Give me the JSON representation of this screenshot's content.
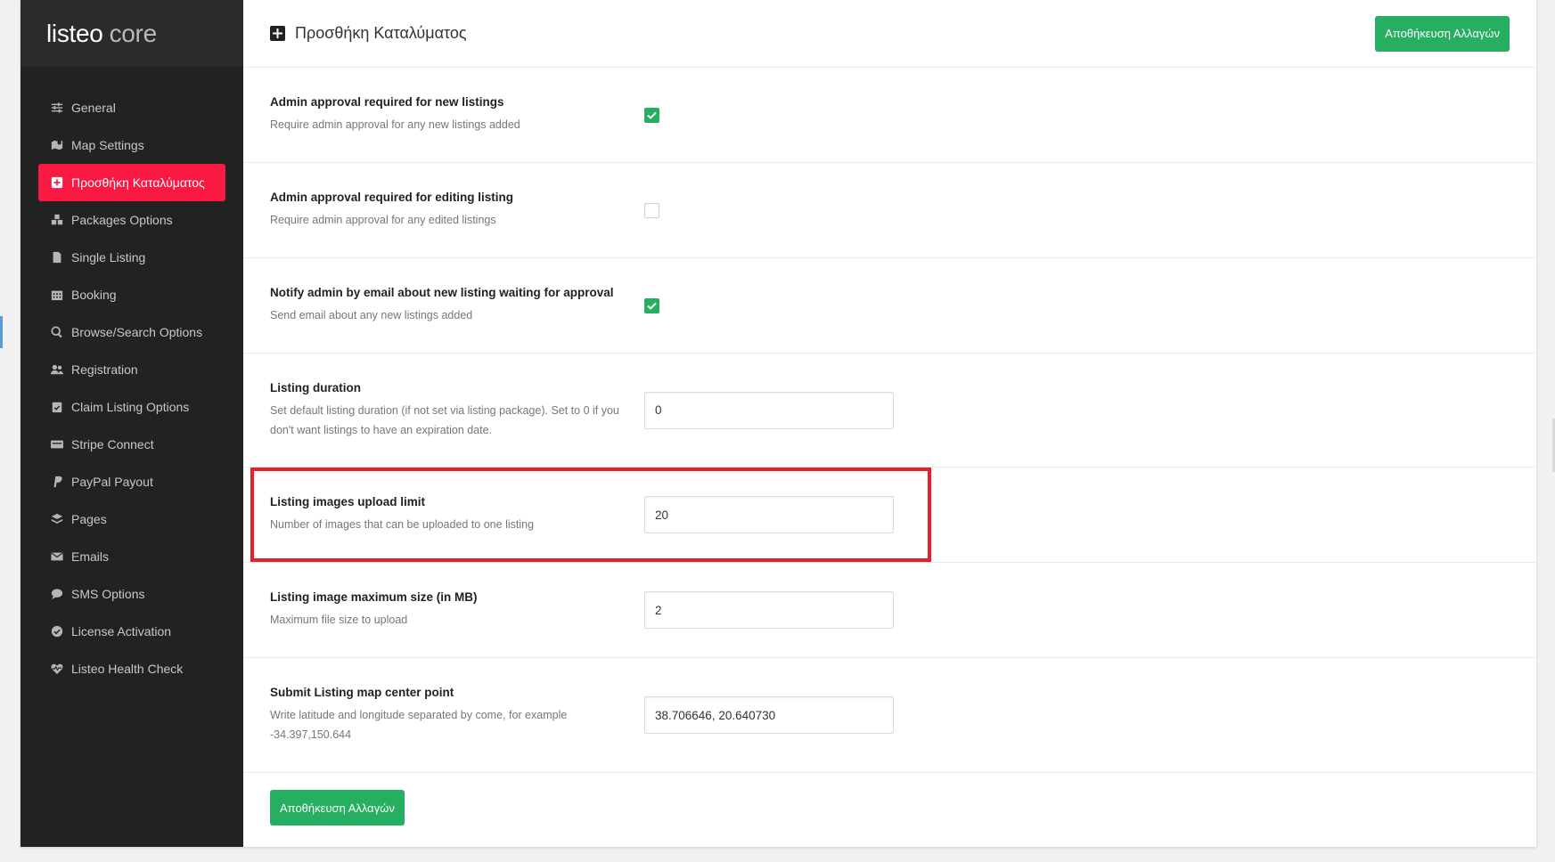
{
  "logo": {
    "main": "listeo",
    "sub": "core"
  },
  "sidebar": {
    "items": [
      {
        "label": "General",
        "icon": "sliders-icon"
      },
      {
        "label": "Map Settings",
        "icon": "map-icon"
      },
      {
        "label": "Προσθήκη Καταλύματος",
        "icon": "plus-square-icon",
        "active": true
      },
      {
        "label": "Packages Options",
        "icon": "cubes-icon"
      },
      {
        "label": "Single Listing",
        "icon": "file-icon"
      },
      {
        "label": "Booking",
        "icon": "calendar-icon"
      },
      {
        "label": "Browse/Search Options",
        "icon": "search-icon"
      },
      {
        "label": "Registration",
        "icon": "users-icon"
      },
      {
        "label": "Claim Listing Options",
        "icon": "clipboard-check-icon"
      },
      {
        "label": "Stripe Connect",
        "icon": "stripe-card-icon"
      },
      {
        "label": "PayPal Payout",
        "icon": "paypal-icon"
      },
      {
        "label": "Pages",
        "icon": "layers-icon"
      },
      {
        "label": "Emails",
        "icon": "envelope-icon"
      },
      {
        "label": "SMS Options",
        "icon": "chat-bubble-icon"
      },
      {
        "label": "License Activation",
        "icon": "check-circle-icon"
      },
      {
        "label": "Listeo Health Check",
        "icon": "heartbeat-icon"
      }
    ]
  },
  "header": {
    "title": "Προσθήκη Καταλύματος",
    "save_label": "Αποθήκευση Αλλαγών"
  },
  "settings": {
    "admin_approval_new": {
      "title": "Admin approval required for new listings",
      "desc": "Require admin approval for any new listings added",
      "checked": true
    },
    "admin_approval_edit": {
      "title": "Admin approval required for editing listing",
      "desc": "Require admin approval for any edited listings",
      "checked": false
    },
    "notify_admin": {
      "title": "Notify admin by email about new listing waiting for approval",
      "desc": "Send email about any new listings added",
      "checked": true
    },
    "listing_duration": {
      "title": "Listing duration",
      "desc": "Set default listing duration (if not set via listing package). Set to 0 if you don't want listings to have an expiration date.",
      "value": "0"
    },
    "images_limit": {
      "title": "Listing images upload limit",
      "desc": "Number of images that can be uploaded to one listing",
      "value": "20"
    },
    "image_max_size": {
      "title": "Listing image maximum size (in MB)",
      "desc": "Maximum file size to upload",
      "value": "2"
    },
    "map_center": {
      "title": "Submit Listing map center point",
      "desc": "Write latitude and longitude separated by come, for example -34.397,150.644",
      "value": "38.706646, 20.640730"
    }
  },
  "footer": {
    "save_label": "Αποθήκευση Αλλαγών"
  },
  "colors": {
    "accent": "#f91942",
    "save": "#26ae61",
    "highlight": "#e8202e"
  }
}
